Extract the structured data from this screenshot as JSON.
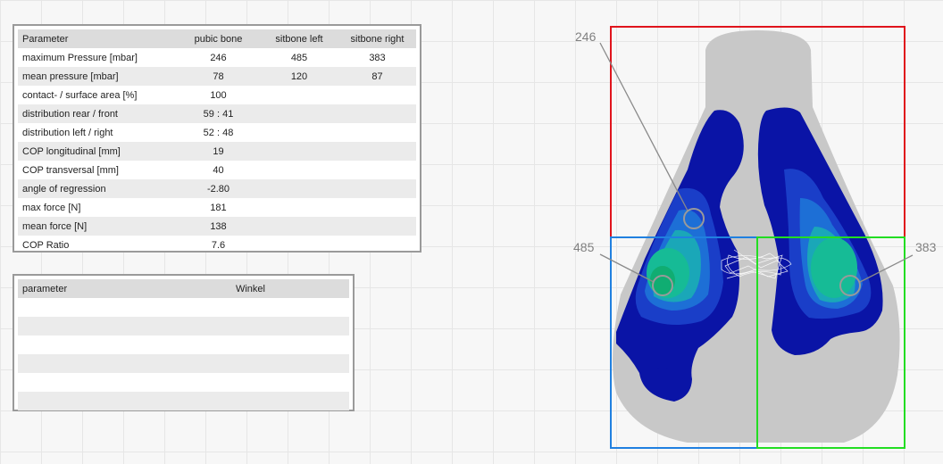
{
  "parameter_table": {
    "headers": [
      "Parameter",
      "pubic bone",
      "sitbone left",
      "sitbone right"
    ],
    "rows": [
      {
        "label": "maximum Pressure [mbar]",
        "values": [
          "246",
          "485",
          "383"
        ]
      },
      {
        "label": "mean pressure [mbar]",
        "values": [
          "78",
          "120",
          "87"
        ]
      },
      {
        "label": "contact- / surface area [%]",
        "value": "100"
      },
      {
        "label": "distribution rear / front",
        "value": "59 : 41"
      },
      {
        "label": "distribution left / right",
        "value": "52 : 48"
      },
      {
        "label": "COP longitudinal [mm]",
        "value": "19"
      },
      {
        "label": "COP transversal [mm]",
        "value": "40"
      },
      {
        "label": "angle of regression",
        "value": "-2.80"
      },
      {
        "label": "max force [N]",
        "value": "181"
      },
      {
        "label": "mean force [N]",
        "value": "138"
      },
      {
        "label": "COP Ratio",
        "value": "7.6"
      }
    ]
  },
  "angle_table": {
    "headers": [
      "parameter",
      "Winkel"
    ],
    "empty_row_count": 6
  },
  "pressure_map": {
    "callouts": {
      "pubic_bone": "246",
      "sitbone_left": "485",
      "sitbone_right": "383"
    },
    "region_colors": {
      "pubic_bone": "#e0141c",
      "sitbone_left": "#2080e0",
      "sitbone_right": "#22dd22"
    },
    "pressure_colors": [
      "#c8c8c8",
      "#0a14a6",
      "#1a3ec8",
      "#1d6fd6",
      "#1aa7b8",
      "#16bb96",
      "#10ad72"
    ]
  }
}
